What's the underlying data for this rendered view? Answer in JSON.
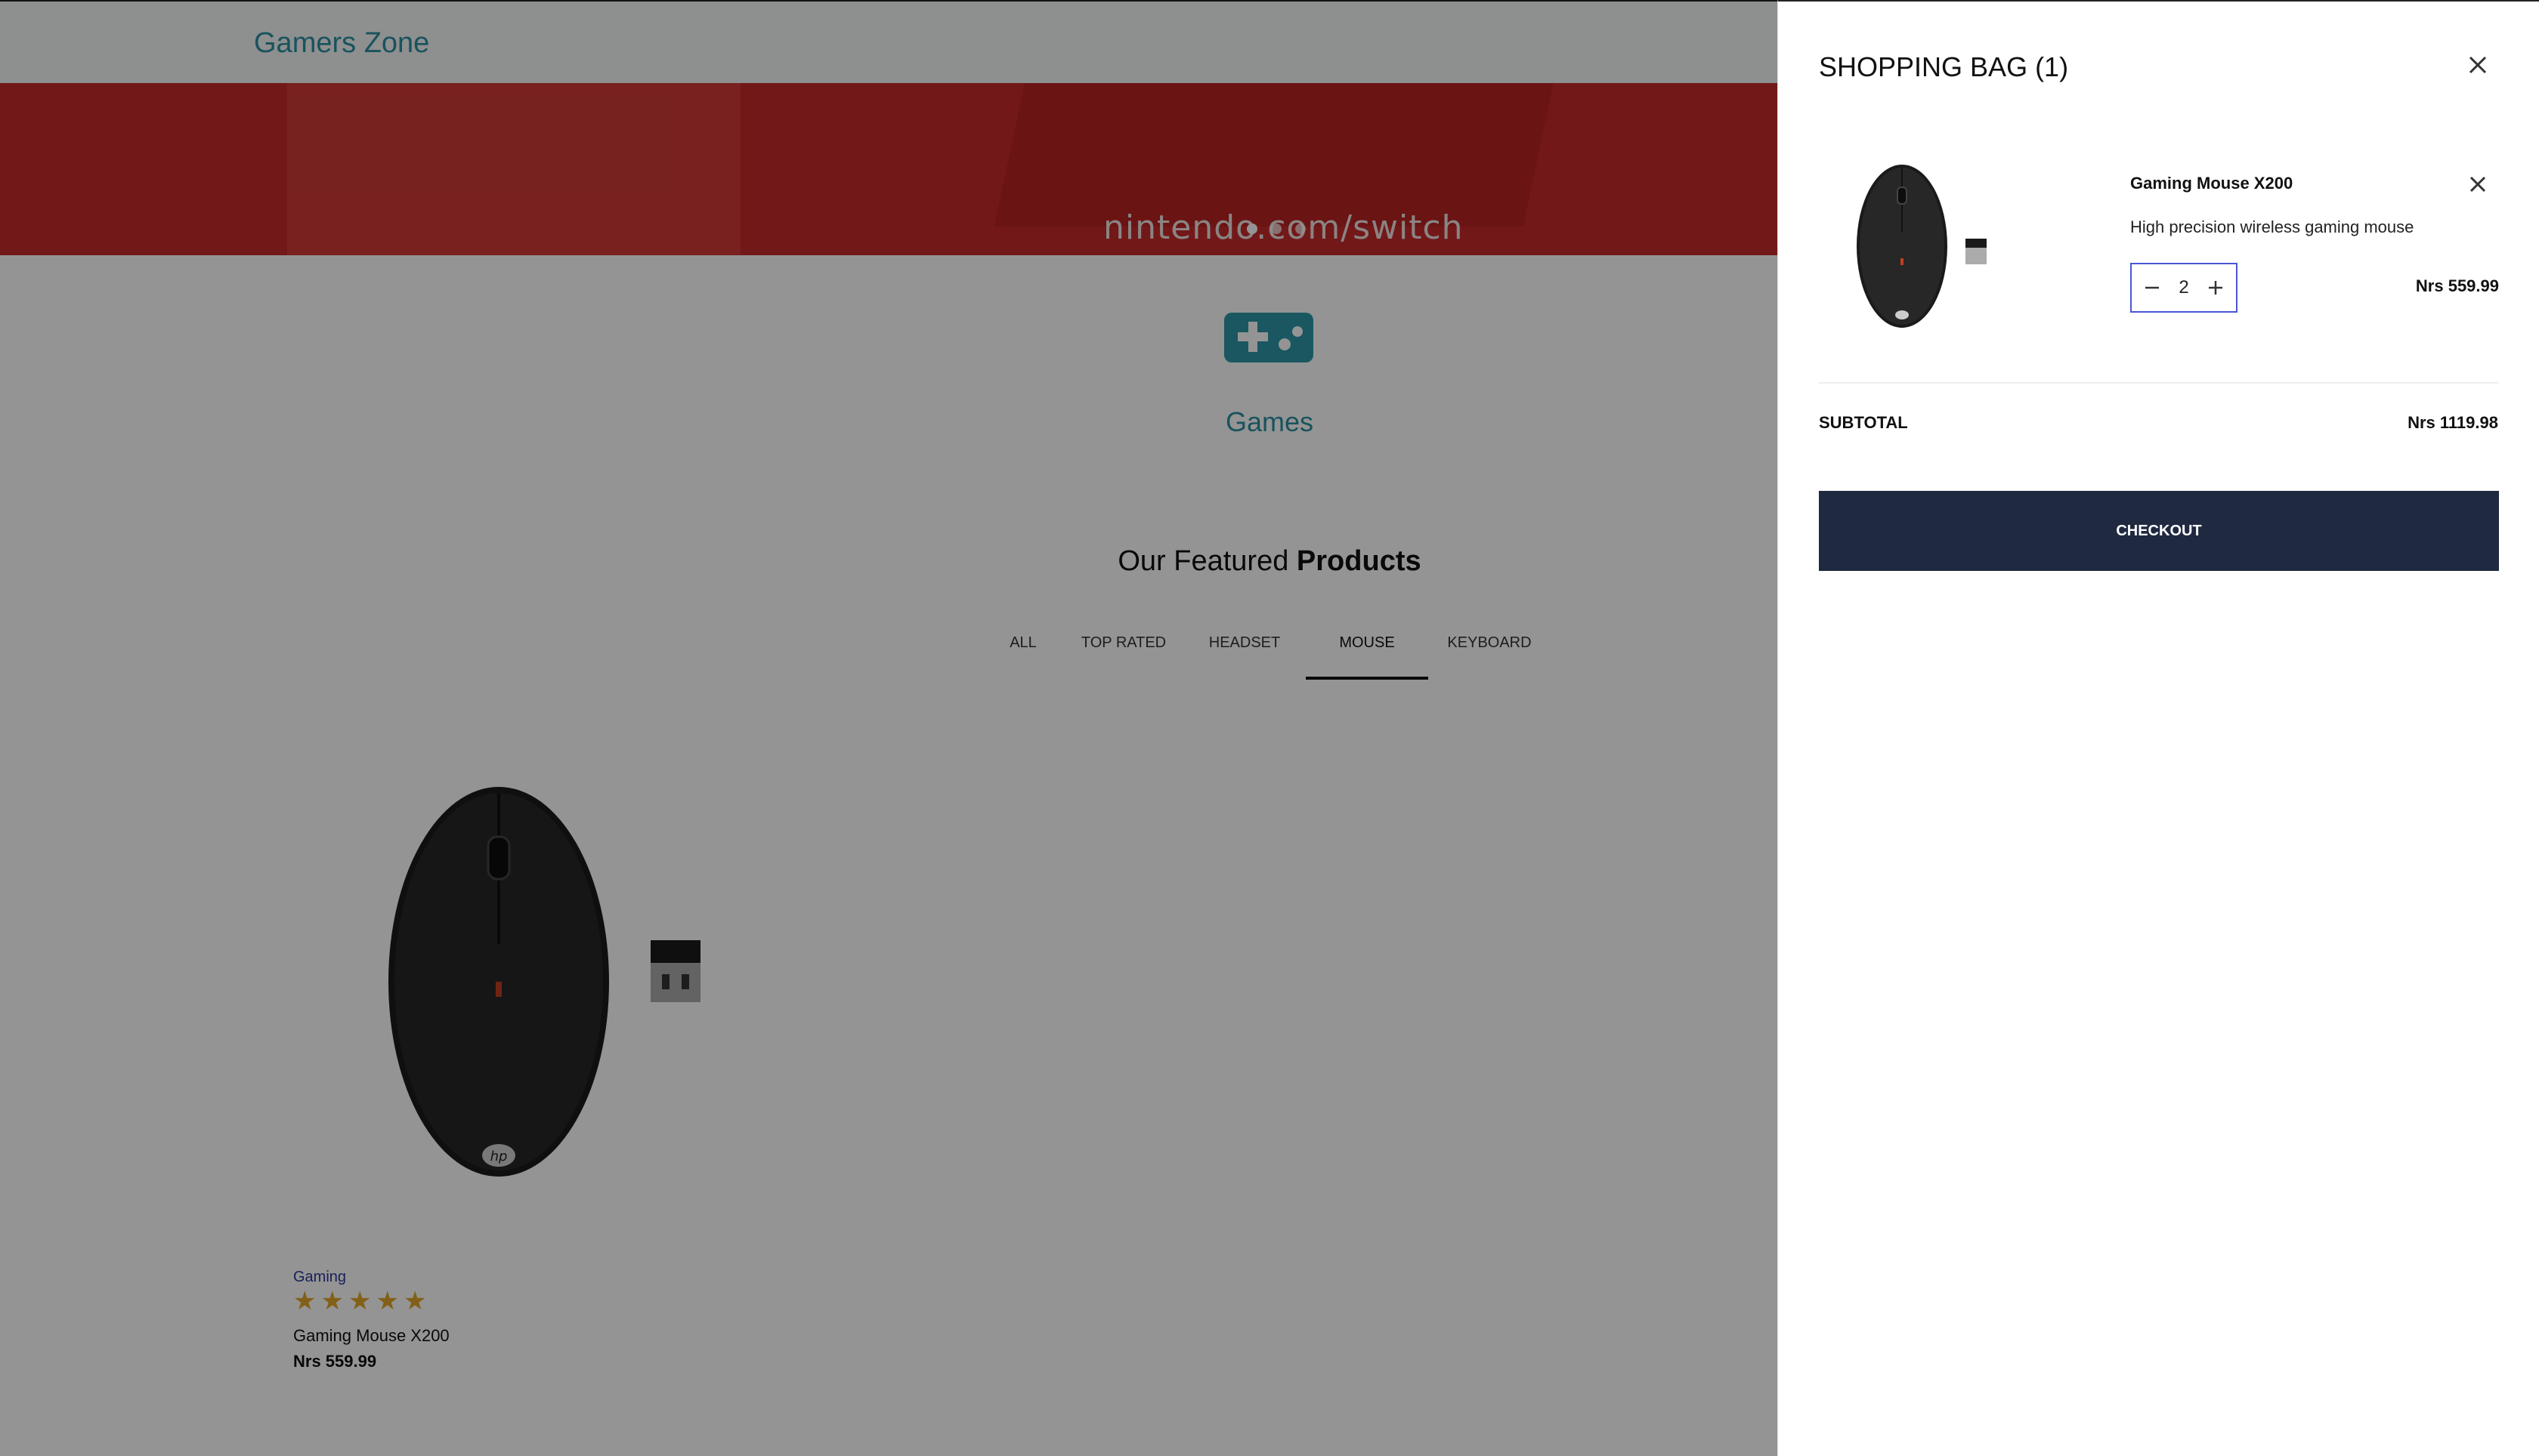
{
  "nav": {
    "brand": "Gamers Zone"
  },
  "hero": {
    "text": "nintendo.com/switch",
    "slide_count": 3,
    "active_slide": 1
  },
  "category": {
    "label": "Games",
    "icon": "gamepad-icon"
  },
  "featured": {
    "title_prefix": "Our Featured ",
    "title_bold": "Products",
    "tabs": [
      "ALL",
      "TOP RATED",
      "HEADSET",
      "MOUSE",
      "KEYBOARD"
    ],
    "active_tab": "MOUSE"
  },
  "product": {
    "category": "Gaming",
    "rating": 5,
    "rating_max": 5,
    "name": "Gaming Mouse X200",
    "price": "Nrs 559.99"
  },
  "bag": {
    "title": "SHOPPING BAG (1)",
    "item": {
      "name": "Gaming Mouse X200",
      "description": "High precision wireless gaming mouse",
      "quantity": "2",
      "price": "Nrs 559.99"
    },
    "subtotal_label": "SUBTOTAL",
    "subtotal_value": "Nrs 1119.98",
    "checkout_label": "CHECKOUT"
  },
  "colors": {
    "accent": "#2b8fa0",
    "hero_red": "#c72a2a",
    "checkout_bg": "#1f2940",
    "star": "#e0a52a",
    "stepper_border": "#4a56d6"
  }
}
